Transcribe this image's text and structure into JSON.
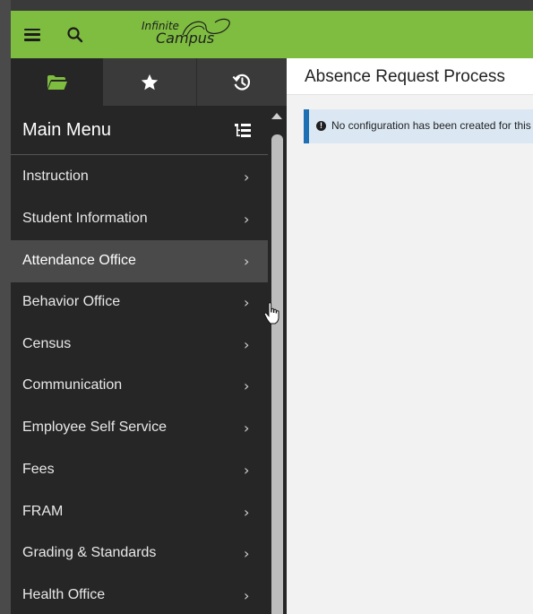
{
  "app": {
    "logo_line1": "Infinite",
    "logo_line2": "Campus"
  },
  "topbar": {
    "menu_icon": "hamburger-icon",
    "search_icon": "search-icon",
    "color": "#7ebd40"
  },
  "sidebar": {
    "tabs": [
      {
        "icon": "folder-open-icon",
        "active": true
      },
      {
        "icon": "star-icon",
        "active": false
      },
      {
        "icon": "history-icon",
        "active": false
      }
    ],
    "title": "Main Menu",
    "title_icon": "tree-view-icon",
    "items": [
      {
        "label": "Instruction"
      },
      {
        "label": "Student Information"
      },
      {
        "label": "Attendance Office",
        "active": true
      },
      {
        "label": "Behavior Office"
      },
      {
        "label": "Census"
      },
      {
        "label": "Communication"
      },
      {
        "label": "Employee Self Service"
      },
      {
        "label": "Fees"
      },
      {
        "label": "FRAM"
      },
      {
        "label": "Grading & Standards"
      },
      {
        "label": "Health Office"
      }
    ]
  },
  "main": {
    "title": "Absence Request Process",
    "alert_text": "No configuration has been created for this school",
    "alert_icon": "exclamation-circle-icon"
  }
}
